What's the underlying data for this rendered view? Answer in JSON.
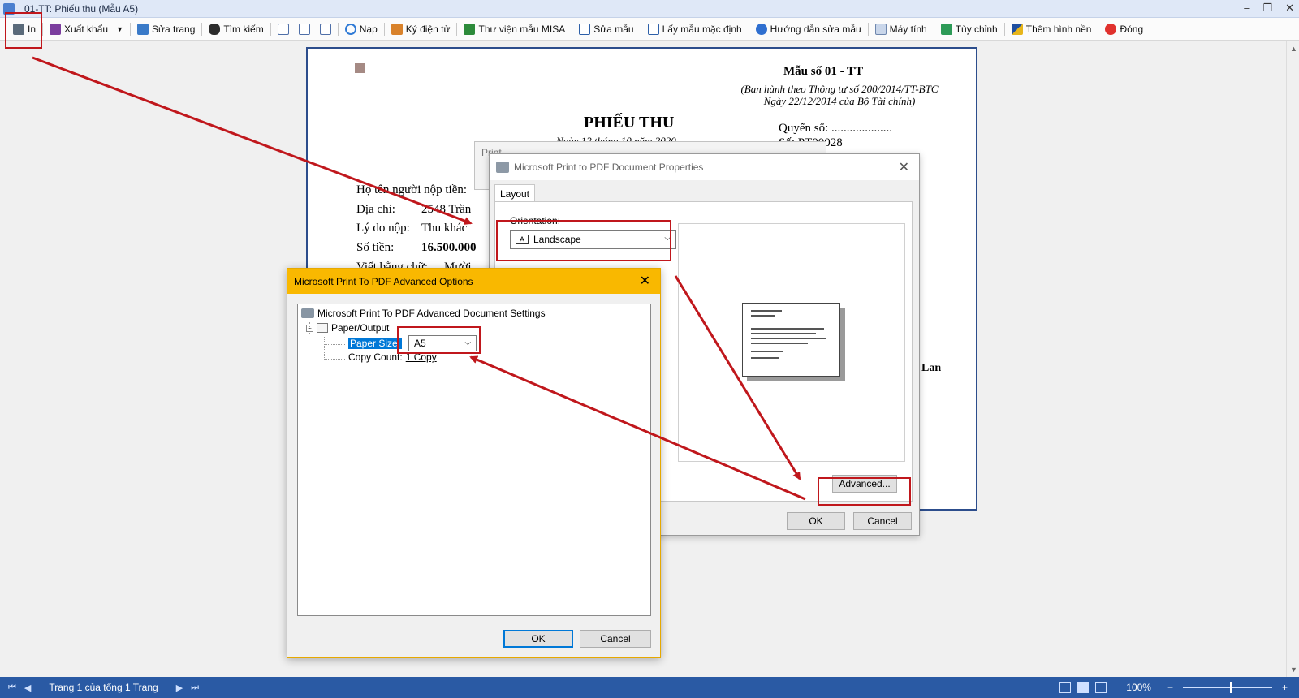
{
  "window": {
    "title": "01-TT: Phiếu thu (Mẫu A5)",
    "controls": [
      "–",
      "❐",
      "✕"
    ]
  },
  "toolbar": {
    "print": "In",
    "export": "Xuất khẩu",
    "edit_page": "Sửa trang",
    "search": "Tìm kiếm",
    "reload": "Nạp",
    "e_sign": "Ký điện tử",
    "misa_library": "Thư viện mẫu MISA",
    "edit_template": "Sửa mẫu",
    "default_template": "Lấy mẫu mặc định",
    "template_guide": "Hướng dẫn sửa mẫu",
    "calculator": "Máy tính",
    "customize": "Tùy chỉnh",
    "add_background": "Thêm hình nền",
    "close": "Đóng"
  },
  "document": {
    "form_no": "Mẫu số 01 - TT",
    "issued_by_line1": "(Ban hành theo Thông tư số 200/2014/TT-BTC",
    "issued_by_line2": "Ngày 22/12/2014 của Bộ Tài chính)",
    "title": "PHIẾU THU",
    "date_partial": "Ngày 12 tháng 10 năm 2020",
    "book_label": "Quyển số:",
    "book_value": "....................",
    "number_label": "Số:",
    "number_value": "PT00028",
    "payer_label": "Họ tên người nộp tiền:",
    "address_label": "Địa chỉ:",
    "address_value": "2548 Trần",
    "reason_label": "Lý do nộp:",
    "reason_value": "Thu khác",
    "amount_label": "Số tiền:",
    "amount_value": "16.500.000",
    "writing_label": "Viết bằng chữ:",
    "writing_value": "Mười",
    "right_fragment": "Lan"
  },
  "print_dialog": {
    "title": "Print"
  },
  "properties_dialog": {
    "title": "Microsoft Print to PDF Document Properties",
    "tab": "Layout",
    "orientation_label": "Orientation:",
    "orientation_value": "Landscape",
    "advanced_button": "Advanced...",
    "ok": "OK",
    "cancel": "Cancel"
  },
  "advanced_dialog": {
    "title": "Microsoft Print To PDF Advanced Options",
    "root_node": "Microsoft Print To PDF Advanced Document Settings",
    "paper_output": "Paper/Output",
    "paper_size_label": "Paper Size:",
    "paper_size_value": "A5",
    "copy_count_label": "Copy Count:",
    "copy_count_value": "1 Copy",
    "ok": "OK",
    "cancel": "Cancel"
  },
  "statusbar": {
    "page_text": "Trang 1 của tổng 1 Trang",
    "zoom": "100%"
  },
  "colors": {
    "status_bar": "#2a5aa4",
    "advanced_header": "#f9b800",
    "highlight": "#c0171c",
    "paper_border": "#2c4d8c"
  }
}
